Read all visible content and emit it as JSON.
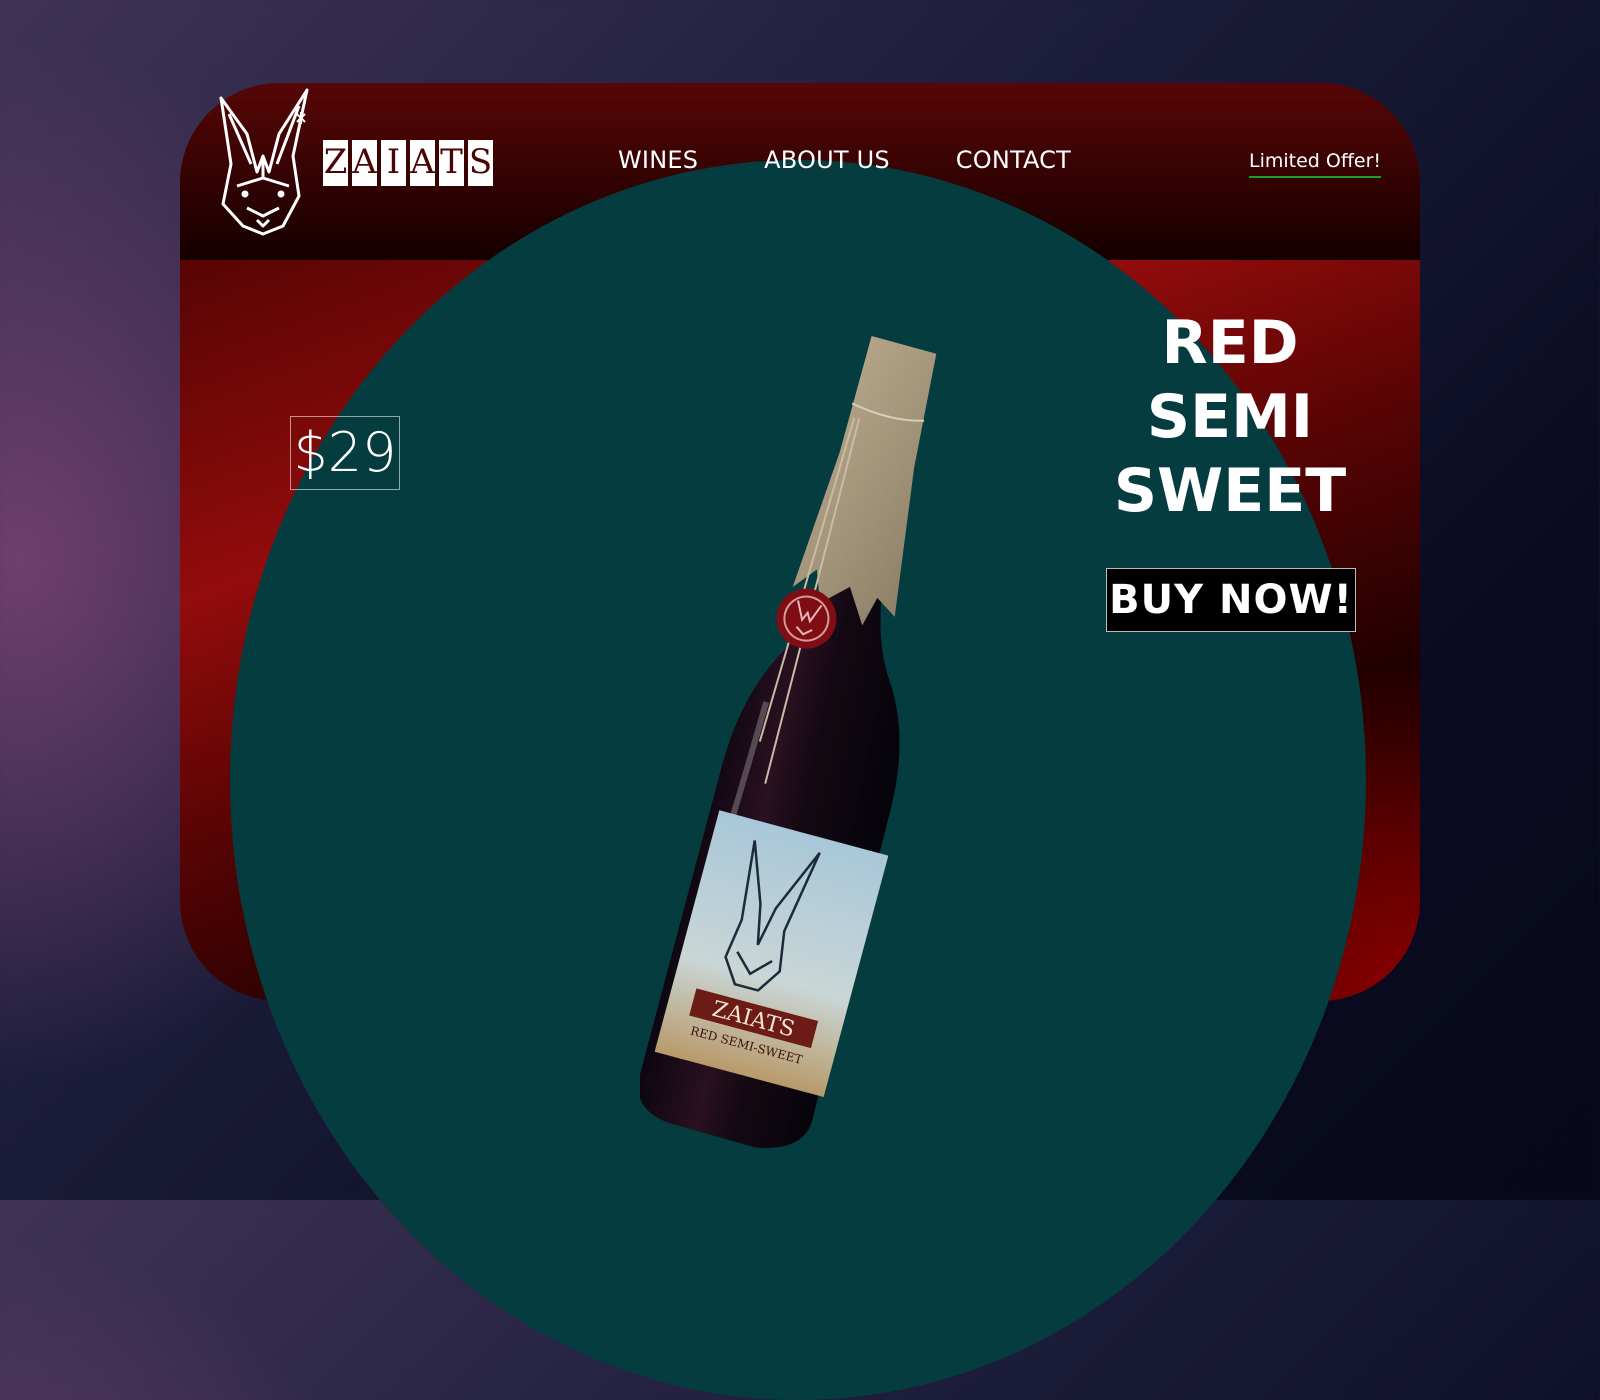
{
  "brand": {
    "logo_letters": [
      "Z",
      "A",
      "I",
      "A",
      "T",
      "S"
    ],
    "label_brand": "ZAIATS",
    "label_variety": "RED SEMI-SWEET"
  },
  "nav": {
    "items": [
      "WINES",
      "ABOUT US",
      "CONTACT"
    ],
    "offer_link": "Limited Offer!"
  },
  "product": {
    "price": "$29",
    "title_lines": [
      "RED",
      "SEMI",
      "SWEET"
    ],
    "cta": "BUY NOW!"
  },
  "colors": {
    "card_red": "#930c0c",
    "hero_teal": "#053c3f",
    "offer_underline": "#1aa31a"
  }
}
